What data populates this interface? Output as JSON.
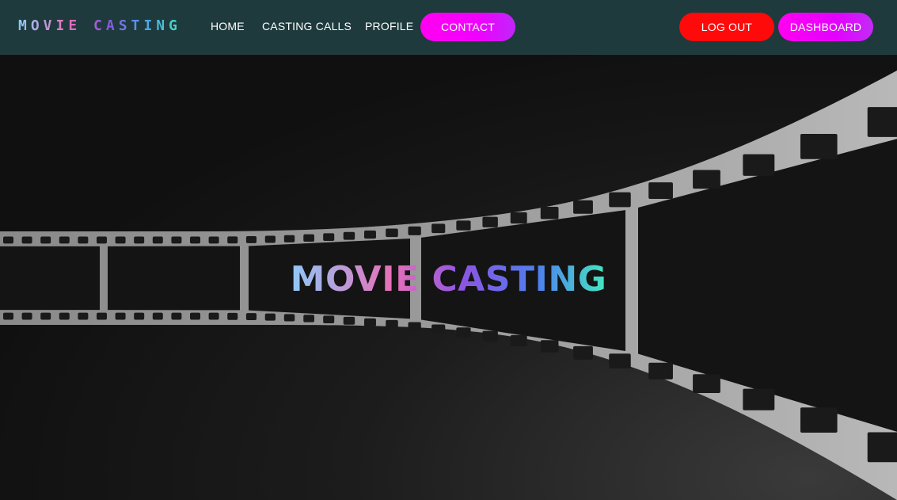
{
  "brand": {
    "name": "MOVIE CASTING"
  },
  "nav": {
    "home": "HOME",
    "casting_calls": "CASTING CALLS",
    "profile": "PROFILE",
    "contact": "CONTACT"
  },
  "account": {
    "logout": "LOG OUT",
    "dashboard": "DASHBOARD"
  },
  "hero": {
    "title": "MOVIE CASTING",
    "background_image": "film-strip"
  },
  "colors": {
    "navbar_bg": "#1e3a3d",
    "contact_button": "#ff00f0",
    "logout_button": "#ff0a0a",
    "dashboard_button": "#e400ff",
    "hero_bg": "#111111"
  }
}
